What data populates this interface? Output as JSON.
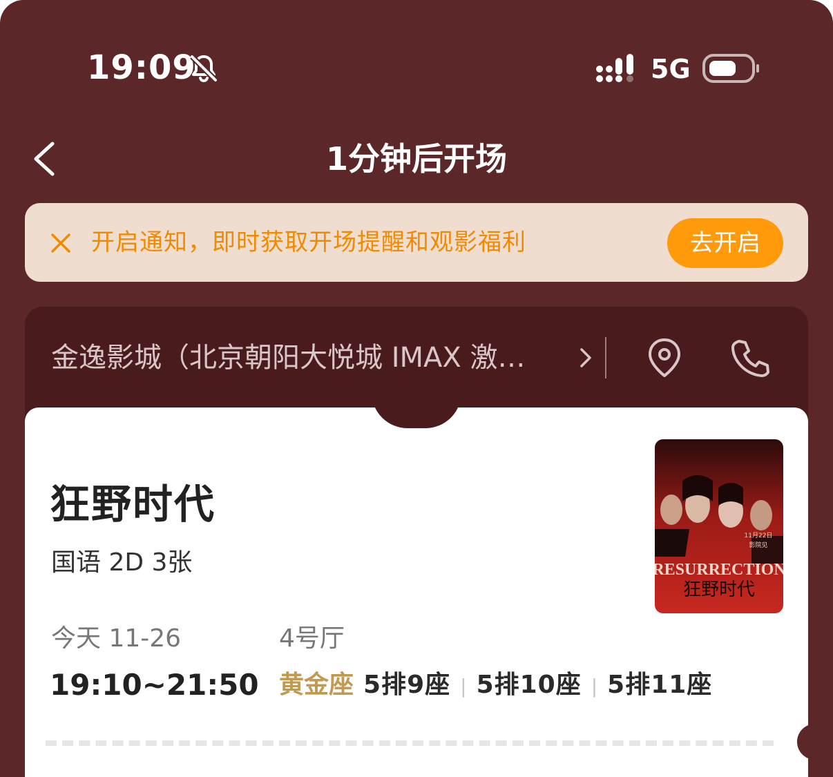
{
  "status_bar": {
    "time": "19:09",
    "network": "5G",
    "icons": [
      "bell-slash-icon",
      "signal-icon",
      "battery-icon"
    ]
  },
  "nav": {
    "title": "1分钟后开场",
    "back_icon": "chevron-left-icon"
  },
  "banner": {
    "text": "开启通知，即时获取开场提醒和观影福利",
    "button_label": "去开启",
    "accent": "#f08a00",
    "button_color": "#ff9a0a"
  },
  "cinema": {
    "name": "金逸影城（北京朝阳大悦城 IMAX 激…",
    "icons": [
      "chevron-right-icon",
      "location-pin-icon",
      "phone-icon"
    ]
  },
  "ticket": {
    "movie_title": "狂野时代",
    "meta": "国语 2D 3张",
    "date": "今天 11-26",
    "time_range": "19:10~21:50",
    "hall": "4号厅",
    "seat_type": "黄金座",
    "seats": [
      "5排9座",
      "5排10座",
      "5排11座"
    ],
    "poster": {
      "title_en": "RESURRECTION",
      "title_cn": "狂野时代",
      "date_text": "11月22日",
      "release_text": "影院见"
    }
  },
  "colors": {
    "background": "#5b2729",
    "card": "#4a1b1d",
    "seat_type": "#c19a4f"
  }
}
